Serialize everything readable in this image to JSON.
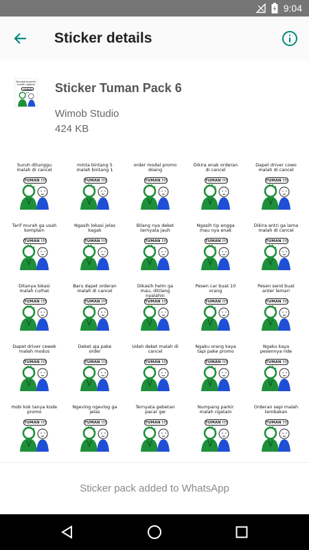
{
  "status_bar": {
    "time": "9:04"
  },
  "app_bar": {
    "title": "Sticker details"
  },
  "pack": {
    "name": "Sticker Tuman Pack 6",
    "publisher": "Wimob Studio",
    "size": "424 KB",
    "tray_caption": "Numpang parkir malah ngatain",
    "tray_label": "TUMAN !!!"
  },
  "stickers": [
    {
      "caption": "Suruh ditunggu malah di cancel",
      "label": "TUMAN !!!"
    },
    {
      "caption": "minta bintang 5 malah bintang 1",
      "label": "TUMAN !!!"
    },
    {
      "caption": "order modal promo doang",
      "label": "TUMAN !!!"
    },
    {
      "caption": "Dikira enak orderan di cancel",
      "label": "TUMAN !!!"
    },
    {
      "caption": "Dapet driver cowo malah di cancel",
      "label": "TUMAN !!!"
    },
    {
      "caption": "Tarif murah ga usah komplain",
      "label": "TUMAN !!!"
    },
    {
      "caption": "Ngasih lokasi jelas kagak",
      "label": "TUMAN !!!"
    },
    {
      "caption": "Bilang nya deket ternyata jauh",
      "label": "TUMAN !!!"
    },
    {
      "caption": "Ngasih tip engga mau nya enak",
      "label": "TUMAN !!!"
    },
    {
      "caption": "Dikira antri ga lama malah di cancel",
      "label": "TUMAN !!!"
    },
    {
      "caption": "Ditanya lokasi malah curhat",
      "label": "TUMAN !!!"
    },
    {
      "caption": "Baru dapet orderan malah di cancel",
      "label": "TUMAN !!!"
    },
    {
      "caption": "Dikasih helm ga mau, ditilang nyalahin",
      "label": "TUMAN !!!"
    },
    {
      "caption": "Pesen car buat 10 orang",
      "label": "TUMAN !!!"
    },
    {
      "caption": "Pesen send buat anter lemari",
      "label": "TUMAN !!!"
    },
    {
      "caption": "Dapet driver cewek malah modus",
      "label": "TUMAN !!!"
    },
    {
      "caption": "Deket aja pake order",
      "label": "TUMAN !!!"
    },
    {
      "caption": "Udah deket malah di cancel",
      "label": "TUMAN !!!"
    },
    {
      "caption": "Ngaku orang kaya tapi pake promo",
      "label": "TUMAN !!!"
    },
    {
      "caption": "Ngaku kaya pesennya ride",
      "label": "TUMAN !!!"
    },
    {
      "caption": "Hobi kok tanya kode promo",
      "label": "TUMAN !!!"
    },
    {
      "caption": "Ngevlog ngevlog ga jelas",
      "label": "TUMAN !!!"
    },
    {
      "caption": "Ternyata gebetan pacar gw",
      "label": "TUMAN !!!"
    },
    {
      "caption": "Numpang parkir malah ngatain",
      "label": "TUMAN !!!"
    },
    {
      "caption": "Orderan sepi malah tembakan",
      "label": "TUMAN !!!"
    }
  ],
  "footer": {
    "text": "Sticker pack added to WhatsApp"
  },
  "colors": {
    "accent": "#00897b",
    "status_bar": "#757575",
    "figure_green": "#1e8f3a",
    "figure_blue": "#1f4fd6"
  },
  "icons": {
    "back": "arrow-back-icon",
    "info": "info-icon",
    "nav_back": "nav-back-icon",
    "nav_home": "nav-home-icon",
    "nav_recents": "nav-recents-icon"
  }
}
